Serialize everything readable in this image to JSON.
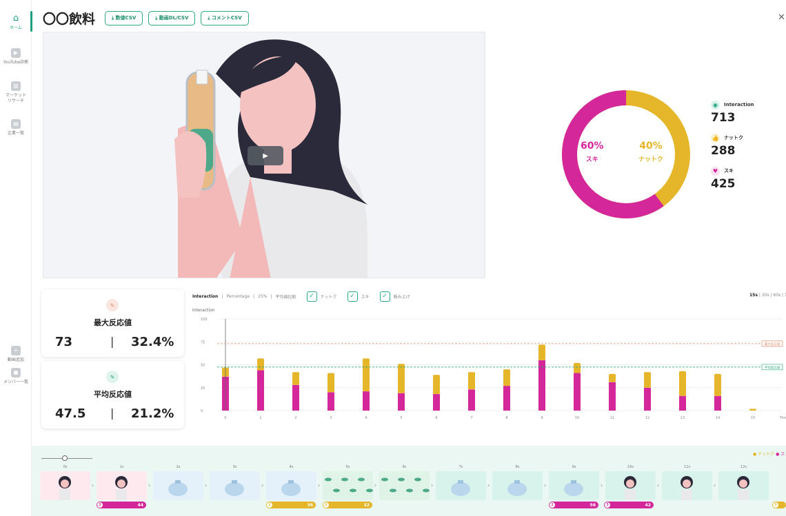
{
  "sidebar": {
    "items": [
      {
        "label": "ホーム",
        "icon": "home-icon"
      },
      {
        "label": "YouTube診断",
        "icon": "youtube-icon"
      },
      {
        "label": "マーケット リサーチ",
        "icon": "chart-icon"
      },
      {
        "label": "企業一覧",
        "icon": "building-icon"
      },
      {
        "label": "動画追加",
        "icon": "plus-icon"
      },
      {
        "label": "メンバー一覧",
        "icon": "person-icon"
      }
    ]
  },
  "header": {
    "title": "〇〇飲料",
    "buttons": [
      "⤓ 数値CSV",
      "⤓ 動画DL/CSV",
      "⤓ コメントCSV"
    ]
  },
  "donut": {
    "left_pct": "60%",
    "left_label": "スキ",
    "right_pct": "40%",
    "right_label": "ナットク",
    "suki_share": 0.6
  },
  "legend": {
    "interaction_label": "Interaction",
    "interaction_value": "713",
    "nattoku_label": "ナットク",
    "nattoku_value": "288",
    "suki_label": "スキ",
    "suki_value": "425"
  },
  "stats": {
    "max": {
      "title": "最大反応値",
      "value": "73",
      "pct": "32.4%"
    },
    "avg": {
      "title": "平均反応値",
      "value": "47.5",
      "pct": "21.2%"
    }
  },
  "chart_toolbar": {
    "modes": [
      "Interaction",
      "Percentage",
      "25%",
      "平均値比較"
    ],
    "checkboxes": [
      "ナットク",
      "スキ",
      "積み上げ"
    ],
    "ranges": [
      "15s",
      "30s",
      "60s",
      "120s"
    ]
  },
  "colors": {
    "suki": "#d4279a",
    "nattoku": "#e5b62a",
    "accent": "#1aa07e",
    "max_line": "#e28a68",
    "avg_line": "#2aa880"
  },
  "chart_data": {
    "type": "bar",
    "ylabel": "Interaction",
    "xlabel": "Time",
    "ylim": [
      0,
      100
    ],
    "yticks": [
      0,
      25,
      50,
      75,
      100
    ],
    "categories": [
      "0",
      "1",
      "2",
      "3",
      "4",
      "5",
      "6",
      "7",
      "8",
      "9",
      "10",
      "11",
      "12",
      "13",
      "14",
      "15"
    ],
    "series": [
      {
        "name": "スキ",
        "values": [
          37,
          44,
          28,
          20,
          21,
          19,
          18,
          23,
          27,
          55,
          41,
          31,
          25,
          16,
          16,
          0
        ]
      },
      {
        "name": "ナットク",
        "values": [
          10,
          13,
          14,
          21,
          36,
          32,
          21,
          19,
          18,
          17,
          11,
          9,
          17,
          27,
          24,
          2
        ]
      }
    ],
    "reference_lines": [
      {
        "name": "最大反応値",
        "value": 73
      },
      {
        "name": "平均反応値",
        "value": 47.5
      }
    ]
  },
  "timeline": {
    "legend_nattoku": "● ナットク",
    "legend_suki": "● ス",
    "thumbs": [
      "0s",
      "1s",
      "2s",
      "3s",
      "4s",
      "5s",
      "6s",
      "7s",
      "8s",
      "9s",
      "10s",
      "11s",
      "12s"
    ],
    "pills": [
      {
        "rank": "2",
        "value": "44",
        "color": "suki"
      },
      {
        "rank": "1",
        "value": "36",
        "color": "nattoku"
      },
      {
        "rank": "2",
        "value": "32",
        "color": "nattoku"
      },
      {
        "rank": "1",
        "value": "56",
        "color": "suki"
      },
      {
        "rank": "3",
        "value": "42",
        "color": "suki"
      },
      {
        "rank": "3",
        "value": "",
        "color": "nattoku"
      }
    ]
  }
}
